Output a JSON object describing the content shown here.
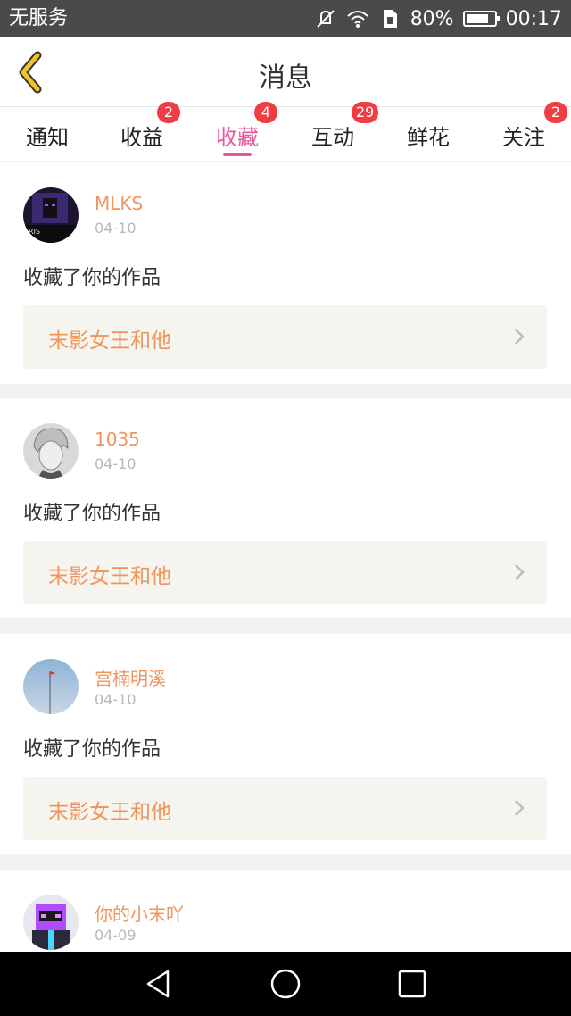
{
  "status_bar": {
    "carrier": "无服务",
    "battery": "80%",
    "battery_level": 0.8,
    "time": "00:17",
    "icons": [
      "mute-icon",
      "wifi-icon",
      "sim-icon",
      "battery-icon"
    ]
  },
  "header": {
    "title": "消息",
    "back_icon": "chevron-left-icon"
  },
  "tabs": [
    {
      "label": "通知",
      "badge": ""
    },
    {
      "label": "收益",
      "badge": "2"
    },
    {
      "label": "收藏",
      "badge": "4",
      "active": true
    },
    {
      "label": "互动",
      "badge": "29"
    },
    {
      "label": "鲜花",
      "badge": ""
    },
    {
      "label": "关注",
      "badge": "2"
    }
  ],
  "messages": [
    {
      "username": "MLKS",
      "date": "04-10",
      "action": "收藏了你的作品",
      "work_title": "末影女王和他"
    },
    {
      "username": "1035",
      "date": "04-10",
      "action": "收藏了你的作品",
      "work_title": "末影女王和他"
    },
    {
      "username": "宫楠明溪",
      "date": "04-10",
      "action": "收藏了你的作品",
      "work_title": "末影女王和他"
    },
    {
      "username": "你的小末吖",
      "date": "04-09",
      "action": "",
      "work_title": ""
    }
  ],
  "colors": {
    "accent": "#e8569b",
    "orange": "#f0945c",
    "badge": "#f03c43",
    "back_arrow": "#f0c22c"
  },
  "nav": [
    "back-triangle-icon",
    "home-circle-icon",
    "recents-square-icon"
  ]
}
